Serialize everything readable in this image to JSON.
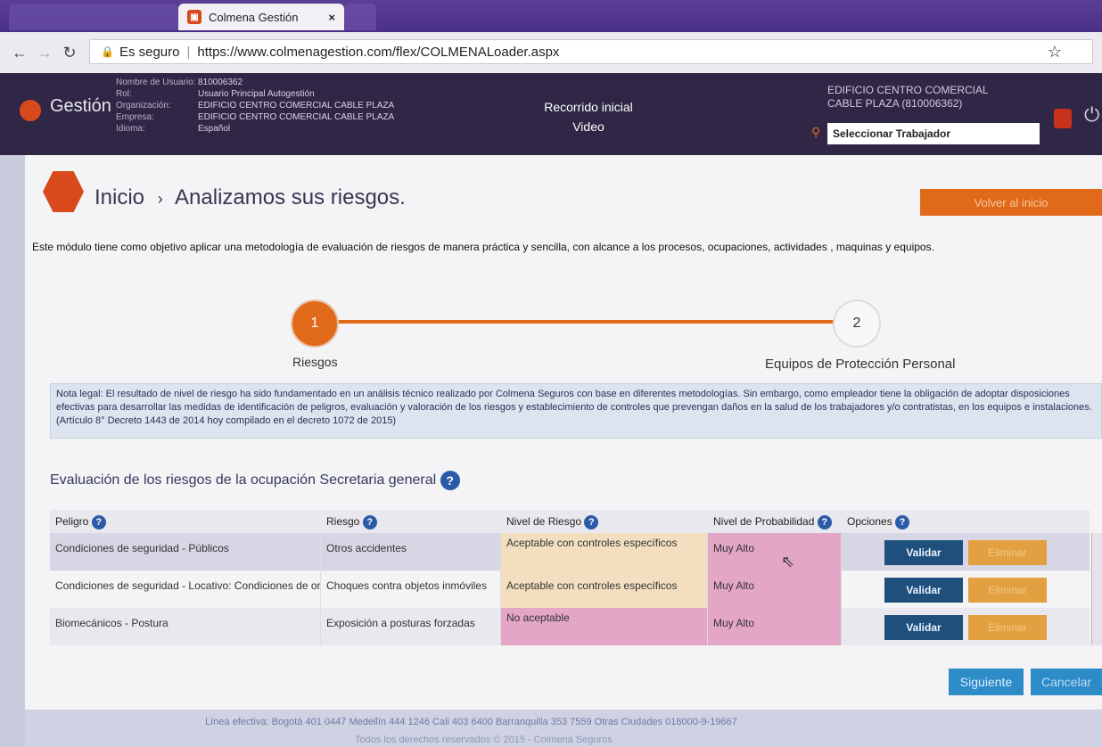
{
  "browser": {
    "tab_active_title": "Colmena Gestión",
    "tab_close": "×",
    "secure_label": "Es seguro",
    "url": "https://www.colmenagestion.com/flex/COLMENALoader.aspx"
  },
  "header": {
    "logo_text": "Gestión",
    "user_info_labels": [
      "Nombre de Usuario:",
      "Rol:",
      "Organización:",
      "Empresa:",
      "Idioma:"
    ],
    "user_info_values": [
      "810006362",
      "Usuario Principal Autogestión",
      "EDIFICIO CENTRO COMERCIAL CABLE PLAZA",
      "EDIFICIO CENTRO COMERCIAL CABLE PLAZA",
      "Español"
    ],
    "tour_link": "Recorrido inicial",
    "video_link": "Video",
    "company_name": "EDIFICIO CENTRO COMERCIAL CABLE PLAZA (810006362)",
    "worker_placeholder": "Seleccionar Trabajador"
  },
  "page": {
    "breadcrumb_home": "Inicio",
    "breadcrumb_sep": "›",
    "breadcrumb_current": "Analizamos sus riesgos.",
    "back_button": "Volver al inicio",
    "intro": "Este módulo tiene como objetivo aplicar una metodología de evaluación de riesgos de manera práctica y sencilla, con alcance a los procesos, ocupaciones, actividades , maquinas y equipos."
  },
  "steps": [
    {
      "number": "1",
      "label": "Riesgos"
    },
    {
      "number": "2",
      "label": "Equipos de Protección Personal"
    }
  ],
  "note": "Nota legal: El resultado de nivel de riesgo ha sido fundamentado en un análisis técnico realizado  por Colmena Seguros con base en diferentes metodologías. Sin embargo, como empleador tiene la obligación de adoptar disposiciones efectivas para desarrollar las medidas de identificación de peligros, evaluación y valoración de los riesgos y establecimiento de controles que prevengan daños en la salud de los trabajadores y/o contratistas, en los equipos e instalaciones. (Artículo 8° Decreto 1443 de 2014 hoy compilado en el decreto 1072 de 2015)",
  "evaluation_title": "Evaluación de los riesgos de la ocupación Secretaria general",
  "table": {
    "headers": [
      "Peligro",
      "Riesgo",
      "Nivel de Riesgo",
      "Nivel de Probabilidad",
      "Opciones"
    ],
    "rows": [
      {
        "peligro": "Condiciones de seguridad - Públicos",
        "riesgo": "Otros accidentes",
        "nivel_riesgo": "Aceptable con controles específicos",
        "nivel_probabilidad": "Muy Alto"
      },
      {
        "peligro": "Condiciones de seguridad - Locativo: Condiciones de ord",
        "riesgo": "Choques contra objetos inmóviles",
        "nivel_riesgo": "Aceptable con controles específicos",
        "nivel_probabilidad": "Muy Alto"
      },
      {
        "peligro": "Biomecánicos - Postura",
        "riesgo": "Exposición a posturas forzadas",
        "nivel_riesgo": "No aceptable",
        "nivel_probabilidad": "Muy Alto"
      }
    ],
    "validate_label": "Validar",
    "delete_label": "Eliminar"
  },
  "actions": {
    "next": "Siguiente",
    "cancel": "Cancelar"
  },
  "footer": {
    "line1": "Línea efectiva: Bogotá 401 0447 Medellín 444 1246 Cali 403 6400 Barranquilla 353 7559 Otras Ciudades 018000-9-19667",
    "line2": "Todos los derechos reservados © 2015 - Colmena Seguros"
  },
  "colors": {
    "accent": "#e06a1a",
    "header_bg": "#2f2745",
    "validate": "#1f4f7d",
    "acceptable_bg": "#f3dfc0",
    "not_acceptable_bg": "#e3a6c6",
    "probability_bg": "#e3a6c6"
  }
}
